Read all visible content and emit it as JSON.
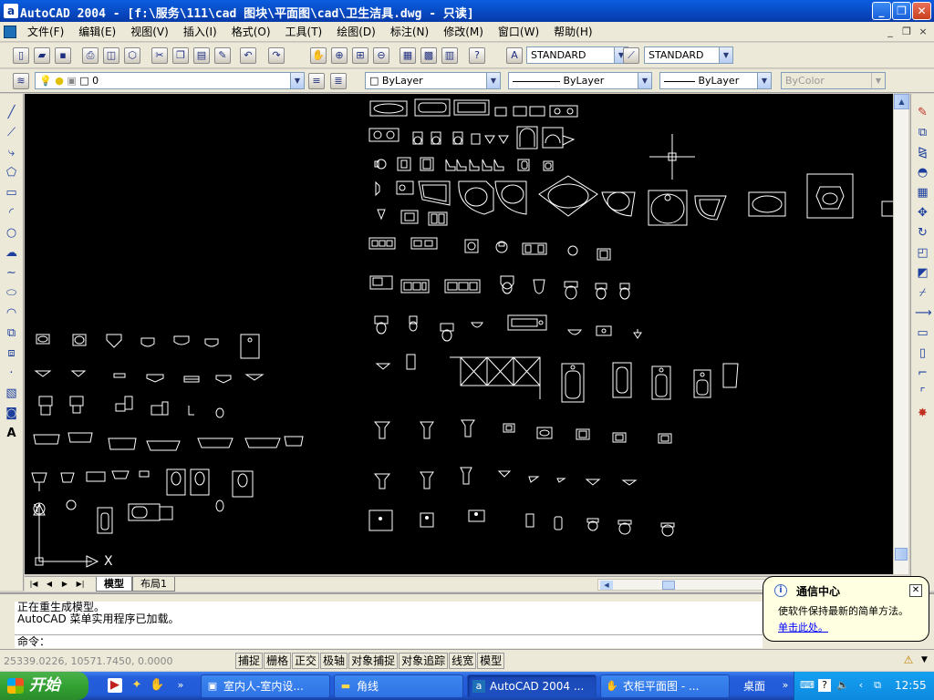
{
  "window": {
    "title": "AutoCAD 2004 - [f:\\服务\\111\\cad 图块\\平面图\\cad\\卫生洁具.dwg - 只读]",
    "minimize_label": "_",
    "maximize_label": "❐",
    "close_label": "✕"
  },
  "menu": {
    "items": [
      "文件(F)",
      "编辑(E)",
      "视图(V)",
      "插入(I)",
      "格式(O)",
      "工具(T)",
      "绘图(D)",
      "标注(N)",
      "修改(M)",
      "窗口(W)",
      "帮助(H)"
    ],
    "doc_min": "_",
    "doc_restore": "❐",
    "doc_close": "×"
  },
  "toolbar": {
    "text_style": "STANDARD",
    "dim_style": "STANDARD",
    "layer": "0",
    "color": "ByLayer",
    "linetype": "ByLayer",
    "lineweight": "ByLayer",
    "plotstyle": "ByColor"
  },
  "layout_tabs": {
    "model": "模型",
    "layout1": "布局1"
  },
  "command": {
    "line1": "正在重生成模型。",
    "line2": "AutoCAD 菜单实用程序已加载。",
    "prompt": "命令："
  },
  "status": {
    "coords": "25339.0226, 10571.7450, 0.0000",
    "buttons": [
      "捕捉",
      "栅格",
      "正交",
      "极轴",
      "对象捕捉",
      "对象追踪",
      "线宽",
      "模型"
    ]
  },
  "balloon": {
    "title": "通信中心",
    "text": "使软件保持最新的简单方法。",
    "link": "单击此处。"
  },
  "ucs": {
    "x_label": "X",
    "y_label": "Y"
  },
  "taskbar": {
    "start": "开始",
    "tasks": [
      "室内人-室内设...",
      "角线",
      "AutoCAD 2004 ...",
      "衣柜平面图 - ..."
    ],
    "desktop": "桌面",
    "clock": "12:55"
  }
}
